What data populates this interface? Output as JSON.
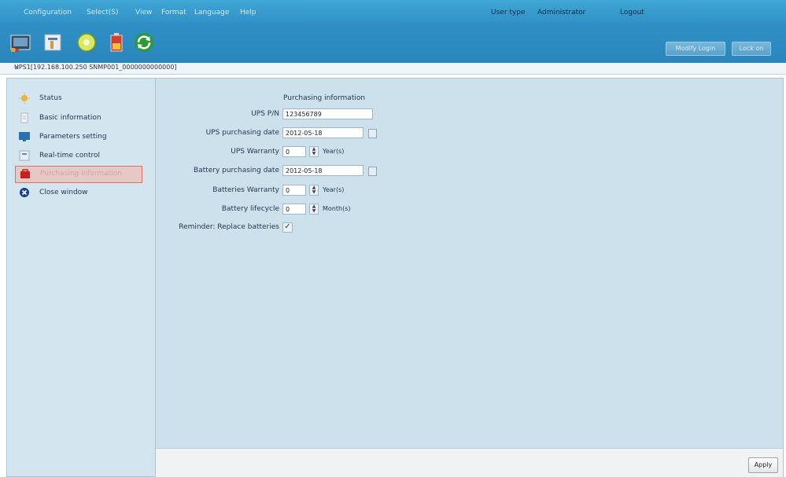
{
  "menu": {
    "items": [
      "Configuration",
      "Select(S)",
      "View",
      "Format",
      "Language",
      "Help"
    ],
    "user_type_label": "User type",
    "user_type_value": "Administrator",
    "logout": "Logout"
  },
  "toolbar": {
    "icons": [
      "monitor-icon",
      "tools-icon",
      "disc-icon",
      "battery-icon",
      "refresh-icon"
    ],
    "buttons": [
      "Modify Login",
      "Lock on"
    ]
  },
  "path": "UPS1[192.168.100.250 SNMP001_0000000000000]",
  "sidebar": {
    "items": [
      {
        "label": "Status",
        "icon": "status-icon"
      },
      {
        "label": "Basic information",
        "icon": "info-icon"
      },
      {
        "label": "Parameters setting",
        "icon": "monitor-settings-icon"
      },
      {
        "label": "Real-time control",
        "icon": "control-icon"
      },
      {
        "label": "Purchasing information",
        "icon": "purchase-icon",
        "selected": true
      },
      {
        "label": "Close window",
        "icon": "close-window-icon"
      }
    ]
  },
  "form": {
    "title": "Purchasing information",
    "ups_pn": {
      "label": "UPS P/N",
      "value": "123456789"
    },
    "ups_purchasing_date": {
      "label": "UPS purchasing date",
      "value": "2012-05-18"
    },
    "ups_warranty": {
      "label": "UPS Warranty",
      "value": "0",
      "unit": "Year(s)"
    },
    "battery_purchasing_date": {
      "label": "Battery purchasing date",
      "value": "2012-05-18"
    },
    "batteries_warranty": {
      "label": "Batteries Warranty",
      "value": "0",
      "unit": "Year(s)"
    },
    "battery_lifecycle": {
      "label": "Battery lifecycle",
      "value": "0",
      "unit": "Month(s)"
    },
    "reminder": {
      "label": "Reminder: Replace batteries",
      "checked": true
    }
  },
  "apply_label": "Apply",
  "colors": {
    "accent": "#2f8fc4",
    "panel": "#cde1ec",
    "selected_border": "#d9736a"
  }
}
